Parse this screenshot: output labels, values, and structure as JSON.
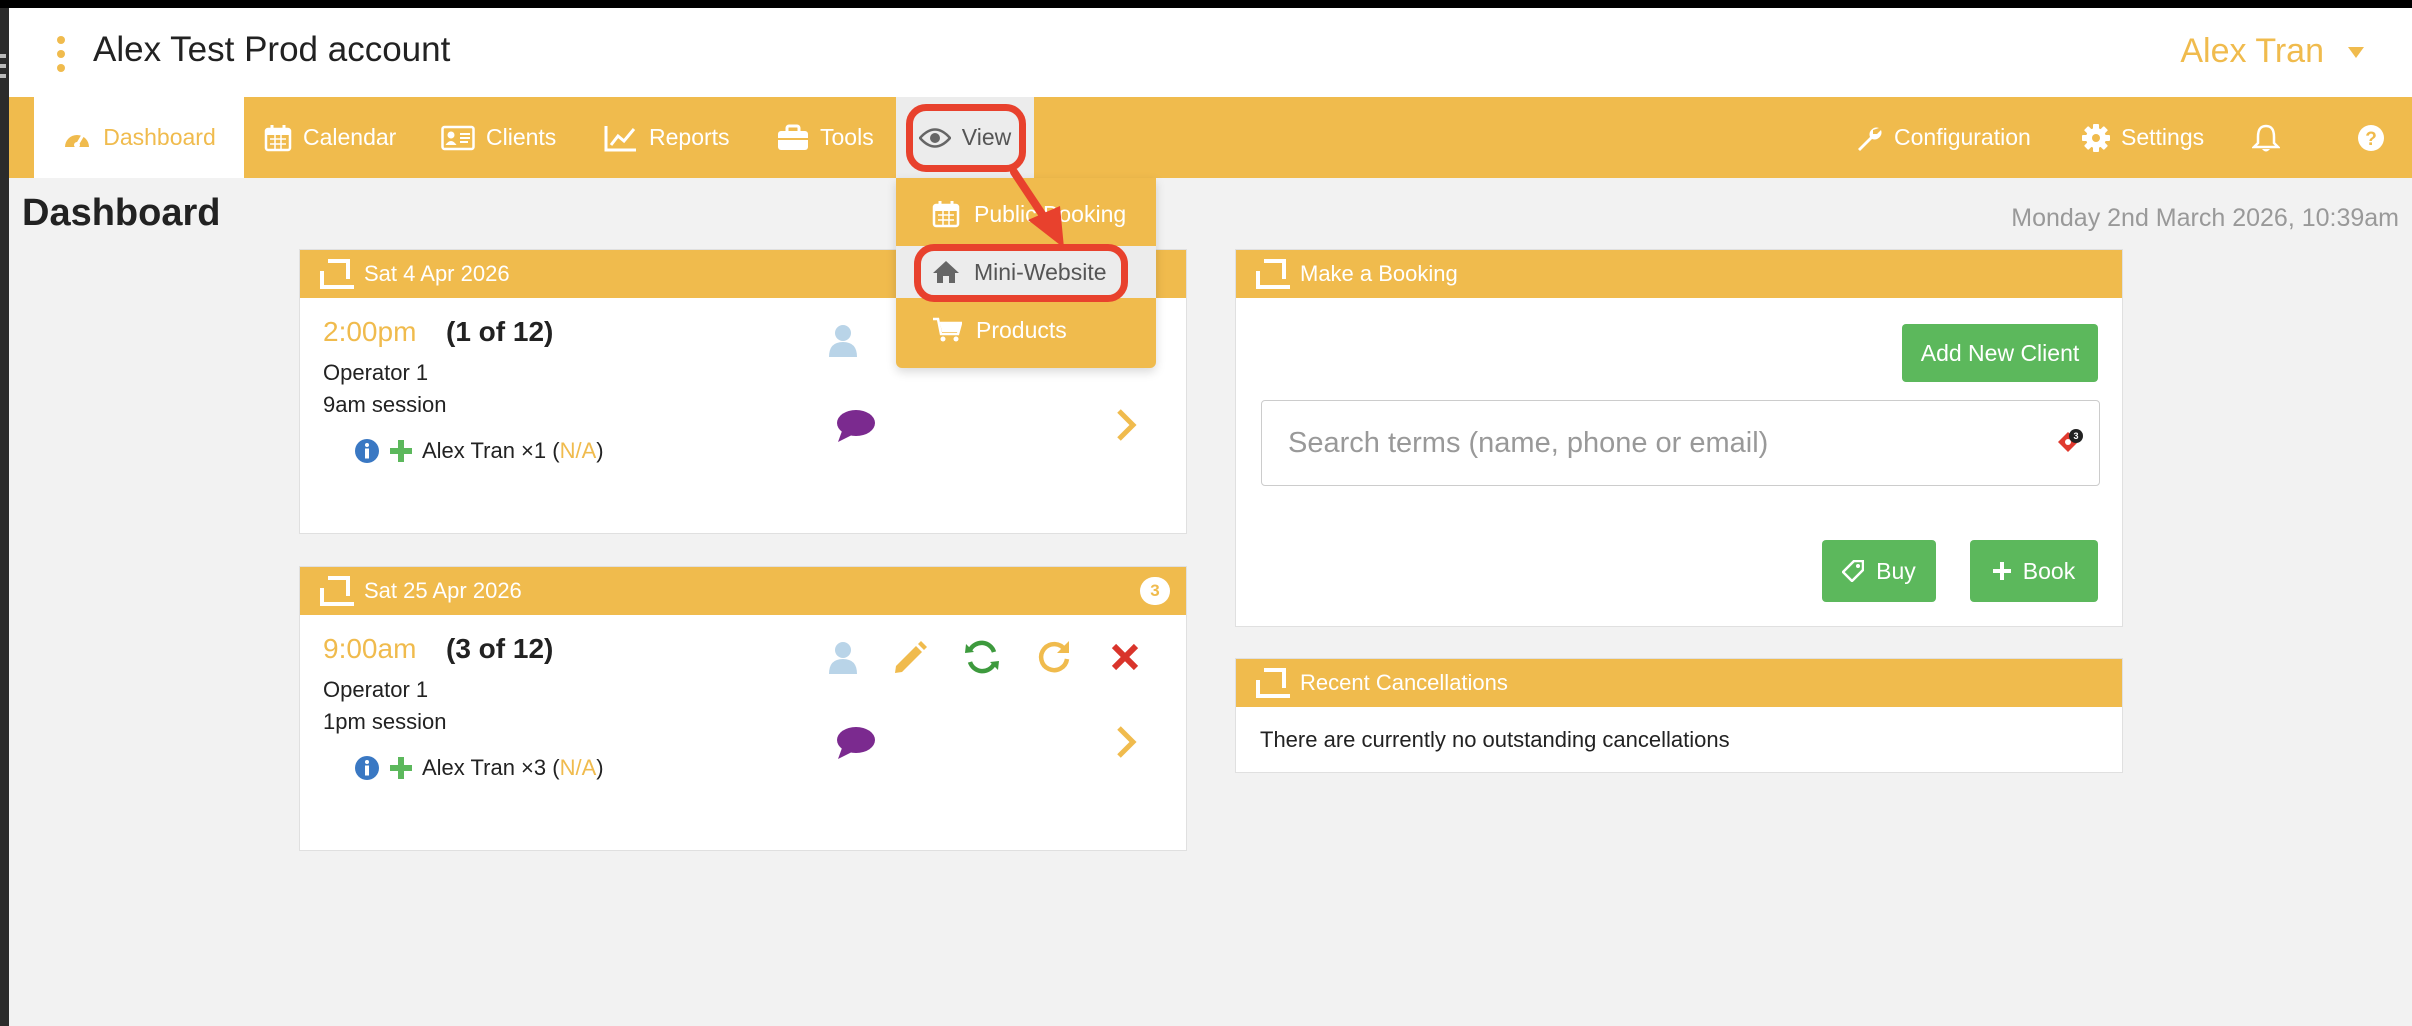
{
  "header": {
    "account_title": "Alex Test Prod account",
    "user_name": "Alex Tran"
  },
  "nav": {
    "dashboard": "Dashboard",
    "calendar": "Calendar",
    "clients": "Clients",
    "reports": "Reports",
    "tools": "Tools",
    "view": "View",
    "configuration": "Configuration",
    "settings": "Settings"
  },
  "view_menu": {
    "items": [
      "Public Booking",
      "Mini-Website",
      "Products"
    ]
  },
  "page": {
    "title": "Dashboard",
    "datetime": "Monday 2nd March 2026, 10:39am"
  },
  "bookings": [
    {
      "date": "Sat 4 Apr 2026",
      "time": "2:00pm",
      "count": "(1 of 12)",
      "operator": "Operator 1",
      "session": "9am session",
      "attendee": "Alex Tran ×1 (",
      "attendee_status": "N/A",
      "close_paren": ")"
    },
    {
      "date": "Sat 25 Apr 2026",
      "badge": "3",
      "time": "9:00am",
      "count": "(3 of 12)",
      "operator": "Operator 1",
      "session": "1pm session",
      "attendee": "Alex Tran ×3 (",
      "attendee_status": "N/A",
      "close_paren": ")"
    }
  ],
  "make_booking": {
    "title": "Make a Booking",
    "add_client": "Add New Client",
    "search_placeholder": "Search terms (name, phone or email)",
    "search_badge": "3",
    "buy": "Buy",
    "book": "Book"
  },
  "cancellations": {
    "title": "Recent Cancellations",
    "message": "There are currently no outstanding cancellations"
  },
  "colors": {
    "brand": "#f0bb4d",
    "success": "#5cb85c",
    "annotation": "#e8412d",
    "info": "#3a78c3",
    "comment": "#7b2a8f",
    "danger": "#d9342b"
  }
}
